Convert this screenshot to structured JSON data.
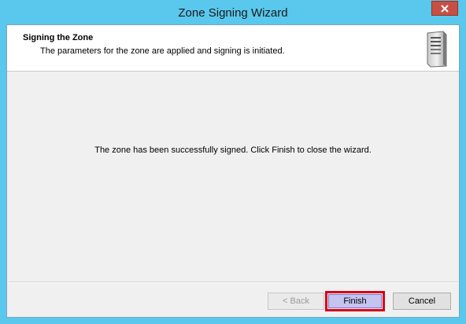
{
  "window": {
    "title": "Zone Signing Wizard"
  },
  "header": {
    "title": "Signing the Zone",
    "subtitle": "The parameters for the zone are applied and signing is initiated."
  },
  "content": {
    "message": "The zone has been successfully signed. Click Finish to close the wizard."
  },
  "buttons": {
    "back": "< Back",
    "finish": "Finish",
    "cancel": "Cancel"
  },
  "icons": {
    "close": "close-icon",
    "header": "server-icon"
  },
  "colors": {
    "titlebar": "#5ac7ec",
    "close_button": "#c74f43",
    "highlight": "#d6001c"
  }
}
